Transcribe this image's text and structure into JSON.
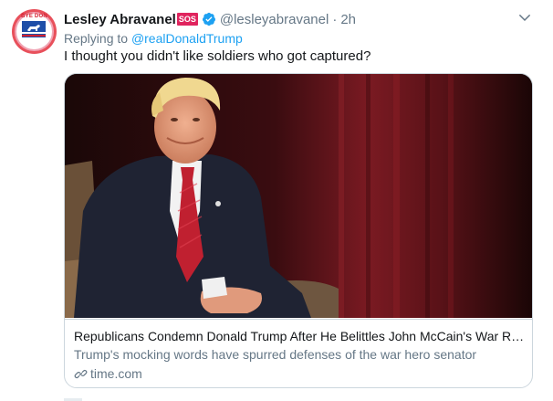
{
  "tweet": {
    "author_name": "Lesley Abravanel",
    "name_badge": "SOS",
    "handle": "@lesleyabravanel",
    "separator": "·",
    "time": "2h",
    "reply_prefix": "Replying to",
    "reply_mention": "@realDonaldTrump",
    "text": "I thought you didn't like soldiers who got captured?"
  },
  "avatar": {
    "top_text": "BYE DON",
    "icon": "donkey-flag-icon"
  },
  "card": {
    "title": "Republicans Condemn Donald Trump After He Belittles John McCain's War Rec...",
    "description": "Trump's mocking words have spurred defenses of the war hero senator",
    "domain": "time.com",
    "link_icon": "link-icon",
    "image_icon": "news-photo"
  },
  "icons": {
    "verified": "verified-badge-icon",
    "menu": "chevron-down-icon"
  },
  "colors": {
    "accent": "#1da1f2",
    "secondary_text": "#657786",
    "primary_text": "#14171a",
    "border": "#ccd6dd",
    "badge": "#e0245e"
  }
}
